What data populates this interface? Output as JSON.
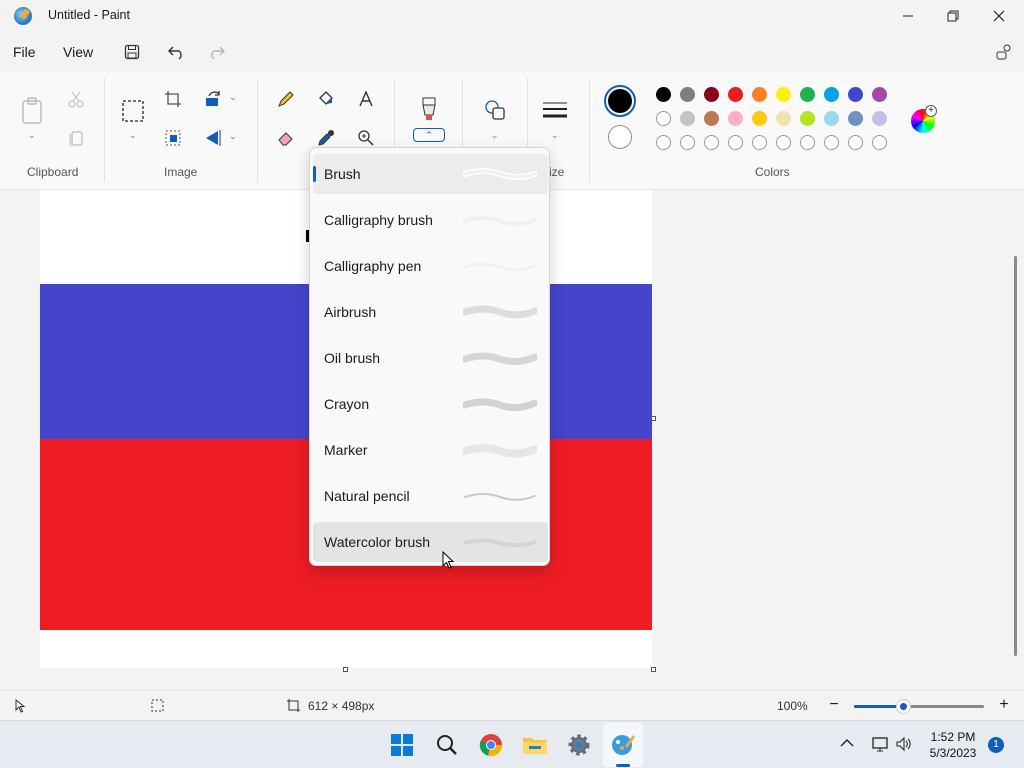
{
  "window": {
    "title": "Untitled - Paint",
    "minimize_icon": "minimize-icon",
    "maximize_icon": "restore-icon",
    "close_icon": "close-icon"
  },
  "menu": {
    "file": "File",
    "view": "View"
  },
  "ribbon": {
    "groups": {
      "clipboard": "Clipboard",
      "image": "Image",
      "size": "ize",
      "colors": "Colors"
    },
    "current_colors": {
      "primary": "#000000",
      "secondary": "#ffffff"
    },
    "palette_row1": [
      "#000000",
      "#7f7f7f",
      "#880015",
      "#ed1c24",
      "#ff7f27",
      "#fff200",
      "#22b14c",
      "#00a2e8",
      "#3f48cc",
      "#a349a4"
    ],
    "palette_row2": [
      "#ffffff",
      "#c3c3c3",
      "#b97a57",
      "#ffaec9",
      "#ffc90e",
      "#efe4b0",
      "#b5e61d",
      "#99d9ea",
      "#7092be",
      "#c8bfe7"
    ],
    "palette_row3": [
      "",
      "",
      "",
      "",
      "",
      "",
      "",
      "",
      "",
      ""
    ]
  },
  "brush_menu": {
    "items": [
      {
        "label": "Brush"
      },
      {
        "label": "Calligraphy brush"
      },
      {
        "label": "Calligraphy pen"
      },
      {
        "label": "Airbrush"
      },
      {
        "label": "Oil brush"
      },
      {
        "label": "Crayon"
      },
      {
        "label": "Marker"
      },
      {
        "label": "Natural pencil"
      },
      {
        "label": "Watercolor brush"
      }
    ],
    "selected": "Brush",
    "hovered": "Watercolor brush"
  },
  "canvas": {
    "colors": {
      "top": "#ffffff",
      "middle": "#4444cc",
      "bottom": "#ee1c24"
    }
  },
  "status": {
    "canvas_size": "612 × 498px",
    "zoom": "100%",
    "zoom_level": 0.38
  },
  "taskbar": {
    "time": "1:52 PM",
    "date": "5/3/2023",
    "notifications": "1"
  }
}
